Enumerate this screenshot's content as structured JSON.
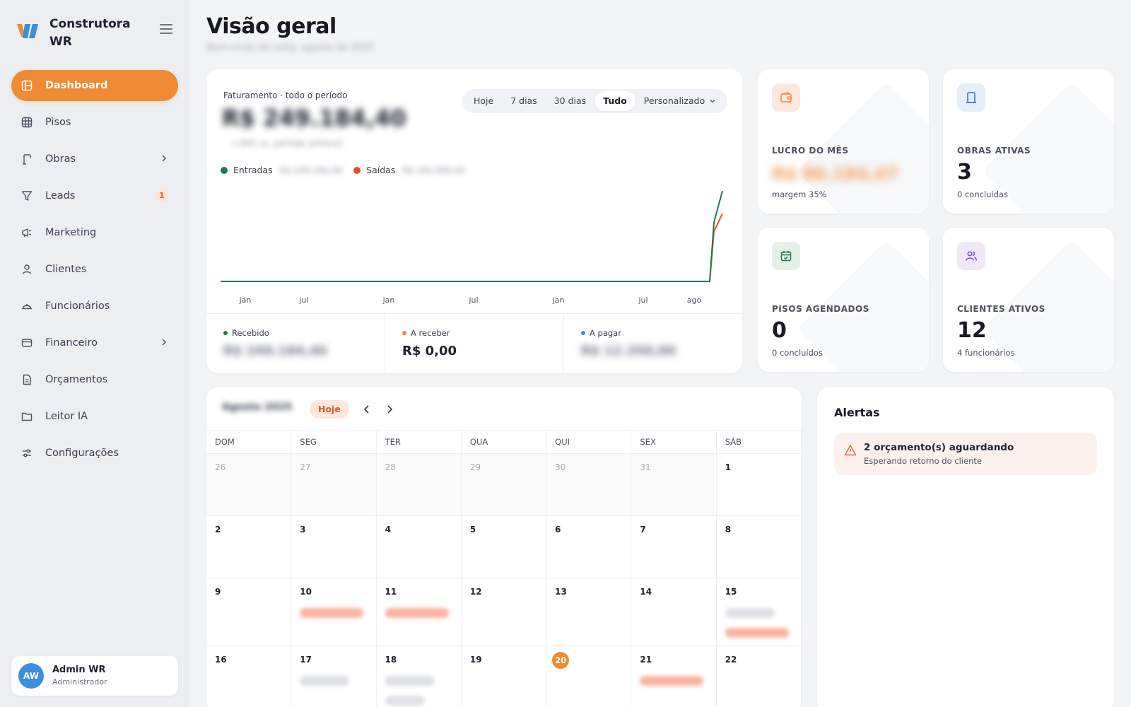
{
  "brand": {
    "name": "Construtora WR"
  },
  "colors": {
    "accent": "#ef8b34",
    "entradas": "#1f7a4d",
    "saidas": "#e4502a",
    "areceber": "#ef8b34",
    "apagar": "#3b8fde"
  },
  "sidebar": {
    "items": [
      {
        "label": "Dashboard",
        "icon": "dashboard-icon",
        "active": true
      },
      {
        "label": "Pisos",
        "icon": "grid-icon"
      },
      {
        "label": "Obras",
        "icon": "crane-icon",
        "chevron": true
      },
      {
        "label": "Leads",
        "icon": "funnel-icon",
        "badge": "1"
      },
      {
        "label": "Marketing",
        "icon": "megaphone-icon"
      },
      {
        "label": "Clientes",
        "icon": "user-icon"
      },
      {
        "label": "Funcionários",
        "icon": "hardhat-icon"
      },
      {
        "label": "Financeiro",
        "icon": "card-icon",
        "chevron": true
      },
      {
        "label": "Orçamentos",
        "icon": "document-icon"
      },
      {
        "label": "Leitor IA",
        "icon": "folder-icon"
      },
      {
        "label": "Configurações",
        "icon": "sliders-icon"
      }
    ]
  },
  "user": {
    "initials": "AW",
    "name": "Admin WR",
    "role": "Administrador"
  },
  "page": {
    "title": "Visão geral",
    "subtitle": "Bem-vindo de volta, agosto de 2025"
  },
  "revenue": {
    "label": "Faturamento · todo o período",
    "total": "R$ 249.184,40",
    "sub": "+18% vs. período anterior",
    "ranges": [
      "Hoje",
      "7 dias",
      "30 dias",
      "Tudo",
      "Personalizado"
    ],
    "active_range": "Tudo",
    "legend_in": "Entradas",
    "legend_in_value": "R$ 249.184,40",
    "legend_out": "Saídas",
    "legend_out_value": "R$ 162.000,00",
    "stats": {
      "recebido_label": "Recebido",
      "recebido_value": "R$ 249.184,40",
      "areceber_label": "A receber",
      "areceber_value": "R$ 0,00",
      "apagar_label": "A pagar",
      "apagar_value": "R$ 12.350,00"
    }
  },
  "chart_data": {
    "type": "line",
    "x": [
      "jan",
      "jul",
      "jan",
      "jul",
      "jan",
      "jul",
      "ago"
    ],
    "series": [
      {
        "name": "Entradas",
        "values": [
          0,
          0,
          0,
          0,
          0,
          0,
          0,
          0.65,
          1.0
        ]
      },
      {
        "name": "Saídas",
        "values": [
          0,
          0,
          0,
          0,
          0,
          0,
          0,
          0.55,
          0.75
        ]
      }
    ],
    "xlabel": "",
    "ylabel": "",
    "title": ""
  },
  "kpis": [
    {
      "label": "LUCRO DO MÊS",
      "value": "R$ 86.184,47",
      "sub": "margem 35%",
      "icon": "wallet-icon",
      "blur": true,
      "bg": "#fde8de",
      "fg": "#ef8b34"
    },
    {
      "label": "OBRAS ATIVAS",
      "value": "3",
      "sub": "0 concluídas",
      "icon": "building-icon",
      "bg": "#e6eef9",
      "fg": "#3b6fb6"
    },
    {
      "label": "PISOS AGENDADOS",
      "value": "0",
      "sub": "0 concluídos",
      "icon": "calendar-check-icon",
      "bg": "#e3f1e9",
      "fg": "#1f7a4d"
    },
    {
      "label": "CLIENTES ATIVOS",
      "value": "12",
      "sub": "4 funcionários",
      "icon": "users-icon",
      "bg": "#efe8f8",
      "fg": "#7a4fc4"
    }
  ],
  "calendar": {
    "month": "Agosto 2025",
    "today_label": "Hoje",
    "weekdays": [
      "DOM",
      "SEG",
      "TER",
      "QUA",
      "QUI",
      "SEX",
      "SÁB"
    ],
    "weeks": [
      [
        "26",
        "27",
        "28",
        "29",
        "30",
        "31",
        "1"
      ],
      [
        "2",
        "3",
        "4",
        "5",
        "6",
        "7",
        "8"
      ],
      [
        "9",
        "10",
        "11",
        "12",
        "13",
        "14",
        "15"
      ],
      [
        "16",
        "17",
        "18",
        "19",
        "20",
        "21",
        "22"
      ]
    ]
  },
  "alerts": {
    "title": "Alertas",
    "items": [
      {
        "text": "2 orçamento(s) aguardando",
        "sub": "Esperando retorno do cliente"
      }
    ]
  }
}
